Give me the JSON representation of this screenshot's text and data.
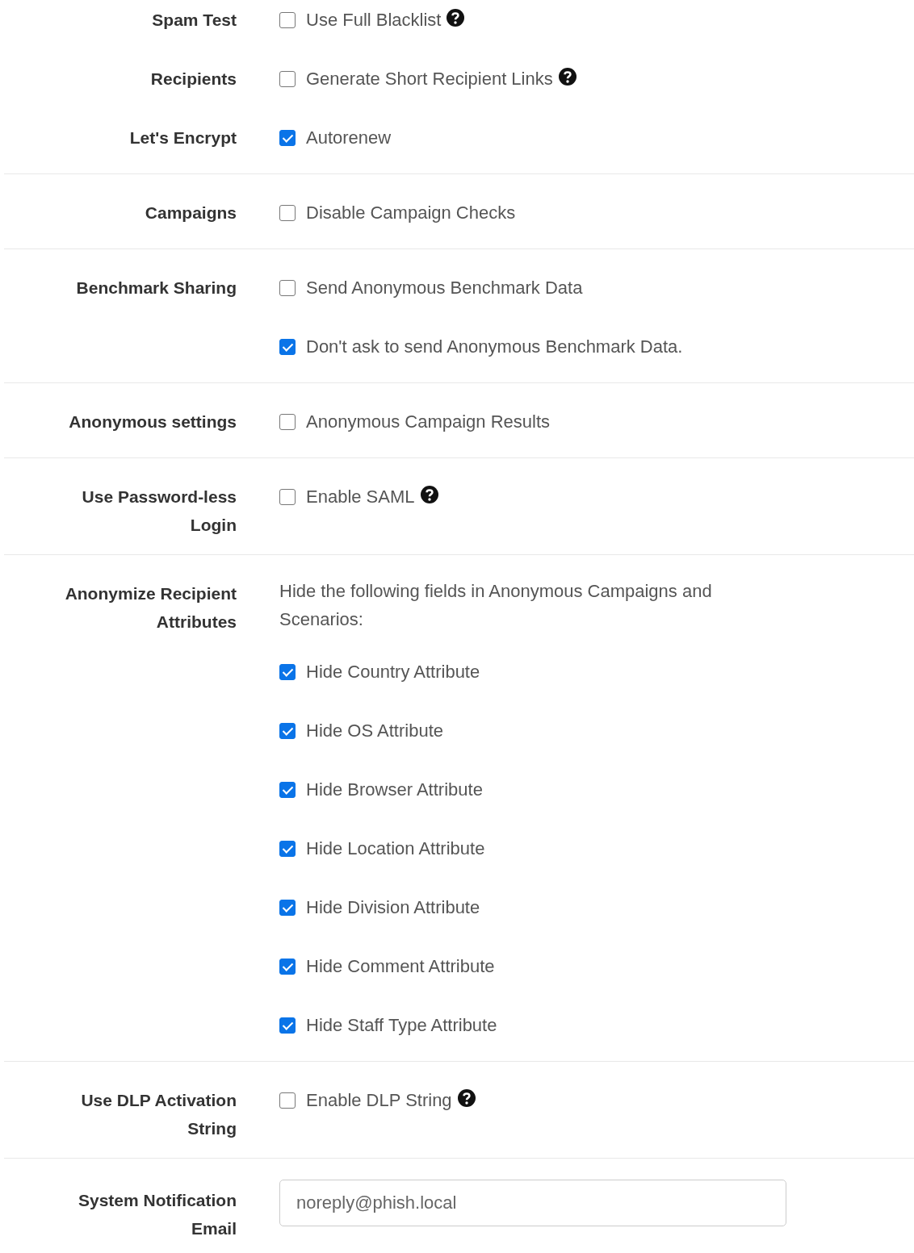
{
  "sections": [
    {
      "rows": [
        {
          "label": "Spam Test",
          "items": [
            {
              "kind": "checkbox",
              "label": "Use Full Blacklist",
              "checked": false,
              "help": true
            }
          ]
        },
        {
          "label": "Recipients",
          "items": [
            {
              "kind": "checkbox",
              "label": "Generate Short Recipient Links",
              "checked": false,
              "help": true
            }
          ]
        },
        {
          "label": "Let's Encrypt",
          "items": [
            {
              "kind": "checkbox",
              "label": "Autorenew",
              "checked": true,
              "help": false
            }
          ]
        }
      ]
    },
    {
      "rows": [
        {
          "label": "Campaigns",
          "items": [
            {
              "kind": "checkbox",
              "label": "Disable Campaign Checks",
              "checked": false,
              "help": false
            }
          ]
        }
      ]
    },
    {
      "rows": [
        {
          "label": "Benchmark Sharing",
          "items": [
            {
              "kind": "checkbox",
              "label": "Send Anonymous Benchmark Data",
              "checked": false,
              "help": false
            },
            {
              "kind": "checkbox",
              "label": "Don't ask to send Anonymous Benchmark Data.",
              "checked": true,
              "help": false
            }
          ]
        }
      ]
    },
    {
      "rows": [
        {
          "label": "Anonymous settings",
          "items": [
            {
              "kind": "checkbox",
              "label": "Anonymous Campaign Results",
              "checked": false,
              "help": false
            }
          ]
        }
      ]
    },
    {
      "rows": [
        {
          "label": "Use Password-less\nLogin",
          "items": [
            {
              "kind": "checkbox",
              "label": "Enable SAML",
              "checked": false,
              "help": true
            }
          ]
        }
      ]
    },
    {
      "rows": [
        {
          "label": "Anonymize Recipient\nAttributes",
          "items": [
            {
              "kind": "text",
              "text": "Hide the following fields in Anonymous Campaigns and Scenarios:"
            },
            {
              "kind": "checkbox",
              "label": "Hide Country Attribute",
              "checked": true,
              "help": false
            },
            {
              "kind": "checkbox",
              "label": "Hide OS Attribute",
              "checked": true,
              "help": false
            },
            {
              "kind": "checkbox",
              "label": "Hide Browser Attribute",
              "checked": true,
              "help": false
            },
            {
              "kind": "checkbox",
              "label": "Hide Location Attribute",
              "checked": true,
              "help": false
            },
            {
              "kind": "checkbox",
              "label": "Hide Division Attribute",
              "checked": true,
              "help": false
            },
            {
              "kind": "checkbox",
              "label": "Hide Comment Attribute",
              "checked": true,
              "help": false
            },
            {
              "kind": "checkbox",
              "label": "Hide Staff Type Attribute",
              "checked": true,
              "help": false
            }
          ]
        }
      ]
    },
    {
      "rows": [
        {
          "label": "Use DLP Activation\nString",
          "items": [
            {
              "kind": "checkbox",
              "label": "Enable DLP String",
              "checked": false,
              "help": true
            }
          ]
        }
      ]
    },
    {
      "rows": [
        {
          "label": "System Notification\nEmail",
          "items": [
            {
              "kind": "input",
              "value": "noreply@phish.local"
            }
          ]
        }
      ]
    }
  ]
}
